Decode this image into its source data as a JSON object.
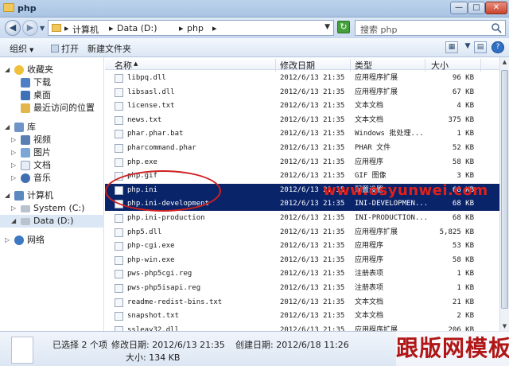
{
  "window": {
    "title": "php"
  },
  "address": {
    "crumbs": [
      "计算机",
      "Data (D:)",
      "php"
    ],
    "search_placeholder": "搜索 php"
  },
  "toolbar": {
    "organize": "组织",
    "open": "打开",
    "new_folder": "新建文件夹"
  },
  "nav": {
    "favorites": "收藏夹",
    "downloads": "下载",
    "desktop": "桌面",
    "recent": "最近访问的位置",
    "libraries": "库",
    "videos": "视频",
    "pictures": "图片",
    "documents": "文档",
    "music": "音乐",
    "computer": "计算机",
    "system_c": "System (C:)",
    "data_d": "Data (D:)",
    "network": "网络"
  },
  "columns": {
    "name": "名称",
    "modified": "修改日期",
    "type": "类型",
    "size": "大小"
  },
  "files": [
    {
      "name": "libpq.dll",
      "date": "2012/6/13 21:35",
      "type": "应用程序扩展",
      "size": "96 KB"
    },
    {
      "name": "libsasl.dll",
      "date": "2012/6/13 21:35",
      "type": "应用程序扩展",
      "size": "67 KB"
    },
    {
      "name": "license.txt",
      "date": "2012/6/13 21:35",
      "type": "文本文档",
      "size": "4 KB"
    },
    {
      "name": "news.txt",
      "date": "2012/6/13 21:35",
      "type": "文本文档",
      "size": "375 KB"
    },
    {
      "name": "phar.phar.bat",
      "date": "2012/6/13 21:35",
      "type": "Windows 批处理...",
      "size": "1 KB"
    },
    {
      "name": "pharcommand.phar",
      "date": "2012/6/13 21:35",
      "type": "PHAR 文件",
      "size": "52 KB"
    },
    {
      "name": "php.exe",
      "date": "2012/6/13 21:35",
      "type": "应用程序",
      "size": "58 KB"
    },
    {
      "name": "php.gif",
      "date": "2012/6/13 21:35",
      "type": "GIF 图像",
      "size": "3 KB"
    },
    {
      "name": "php.ini",
      "date": "2012/6/13 21:35",
      "type": "配置设置",
      "size": "68 KB"
    },
    {
      "name": "php.ini-development",
      "date": "2012/6/13 21:35",
      "type": "INI-DEVELOPMEN...",
      "size": "68 KB"
    },
    {
      "name": "php.ini-production",
      "date": "2012/6/13 21:35",
      "type": "INI-PRODUCTION...",
      "size": "68 KB"
    },
    {
      "name": "php5.dll",
      "date": "2012/6/13 21:35",
      "type": "应用程序扩展",
      "size": "5,825 KB"
    },
    {
      "name": "php-cgi.exe",
      "date": "2012/6/13 21:35",
      "type": "应用程序",
      "size": "53 KB"
    },
    {
      "name": "php-win.exe",
      "date": "2012/6/13 21:35",
      "type": "应用程序",
      "size": "58 KB"
    },
    {
      "name": "pws-php5cgi.reg",
      "date": "2012/6/13 21:35",
      "type": "注册表项",
      "size": "1 KB"
    },
    {
      "name": "pws-php5isapi.reg",
      "date": "2012/6/13 21:35",
      "type": "注册表项",
      "size": "1 KB"
    },
    {
      "name": "readme-redist-bins.txt",
      "date": "2012/6/13 21:35",
      "type": "文本文档",
      "size": "21 KB"
    },
    {
      "name": "snapshot.txt",
      "date": "2012/6/13 21:35",
      "type": "文本文档",
      "size": "2 KB"
    },
    {
      "name": "ssleay32.dll",
      "date": "2012/6/13 21:35",
      "type": "应用程序扩展",
      "size": "206 KB"
    }
  ],
  "details": {
    "selected": "已选择 2 个项",
    "modified": "修改日期: 2012/6/13 21:35",
    "created": "创建日期: 2012/6/18 11:26",
    "size": "大小: 134 KB"
  },
  "watermarks": {
    "site": "www.osyunwei.com",
    "brand": "跟版网模板"
  }
}
